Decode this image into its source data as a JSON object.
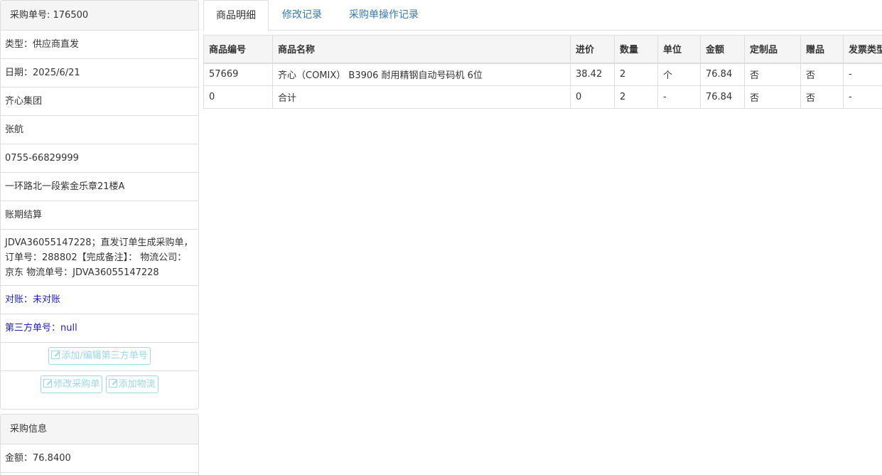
{
  "order": {
    "header": "采购单号: 176500",
    "type": "类型：供应商直发",
    "date": "日期：2025/6/21",
    "supplier": "齐心集团",
    "contact": "张航",
    "phone": "0755-66829999",
    "address": "一环路北一段紫金乐章21楼A",
    "payment": "账期结算",
    "remark": "JDVA36055147228；直发订单生成采购单，订单号：288802【完成备注】： 物流公司：京东 物流单号：JDVA36055147228",
    "reconcile": "对账：未对账",
    "third_party_no": "第三方单号：null",
    "btn_edit_third": "添加/编辑第三方单号",
    "btn_modify": "修改采购单",
    "btn_add_logistics": "添加物流"
  },
  "purchase_info": {
    "header": "采购信息",
    "amount": "金额：76.8400"
  },
  "tabs": [
    "商品明细",
    "修改记录",
    "采购单操作记录"
  ],
  "table": {
    "columns": [
      "商品编号",
      "商品名称",
      "进价",
      "数量",
      "单位",
      "金额",
      "定制品",
      "赠品",
      "发票类型"
    ],
    "rows": [
      [
        "57669",
        "齐心（COMIX） B3906 耐用精钢自动号码机 6位",
        "38.42",
        "2",
        "个",
        "76.84",
        "否",
        "否",
        "-"
      ],
      [
        "0",
        "合计",
        "0",
        "2",
        "-",
        "76.84",
        "否",
        "否",
        "-"
      ]
    ]
  },
  "colors": {
    "link": "#337ab7",
    "blue_text": "#1f1fb8",
    "button_border": "#9bd9e6",
    "header_bg": "#f5f5f5",
    "border": "#ddd"
  }
}
